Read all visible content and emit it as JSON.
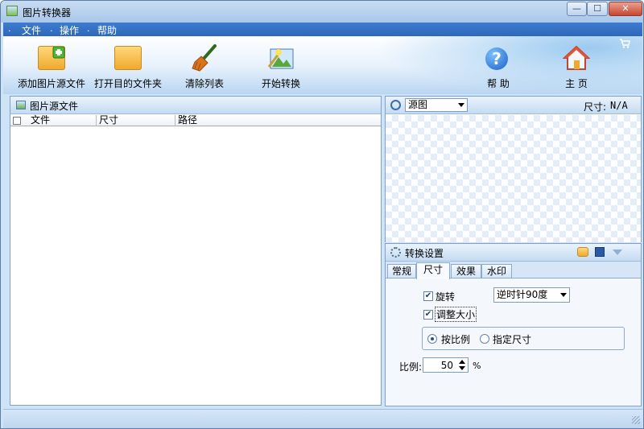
{
  "window": {
    "title": "图片转换器",
    "min_glyph": "—",
    "max_glyph": "☐",
    "close_glyph": "✕"
  },
  "menu": [
    {
      "label": "文件"
    },
    {
      "label": "操作"
    },
    {
      "label": "帮助"
    }
  ],
  "toolbar": {
    "add_source": "添加图片源文件",
    "open_target": "打开目的文件夹",
    "clear_list": "清除列表",
    "start_convert": "开始转换",
    "help": "帮 助",
    "home": "主 页"
  },
  "source_panel": {
    "title": "图片源文件",
    "columns": [
      "文件",
      "尺寸",
      "路径"
    ]
  },
  "preview_panel": {
    "view_select": "源图",
    "size_label": "尺寸:",
    "size_value": "N/A"
  },
  "settings": {
    "title": "转换设置",
    "tabs": [
      "常规",
      "尺寸",
      "效果",
      "水印"
    ],
    "active_tab": "尺寸",
    "rotate_label": "旋转",
    "rotate_checked": true,
    "rotate_option": "逆时针90度",
    "resize_label": "调整大小",
    "resize_checked": true,
    "by_ratio_label": "按比例",
    "by_size_label": "指定尺寸",
    "ratio_label": "比例:",
    "ratio_value": "50",
    "ratio_unit": "%"
  },
  "colors": {
    "accent": "#2e68b8",
    "panel_border": "#7da2ce"
  }
}
